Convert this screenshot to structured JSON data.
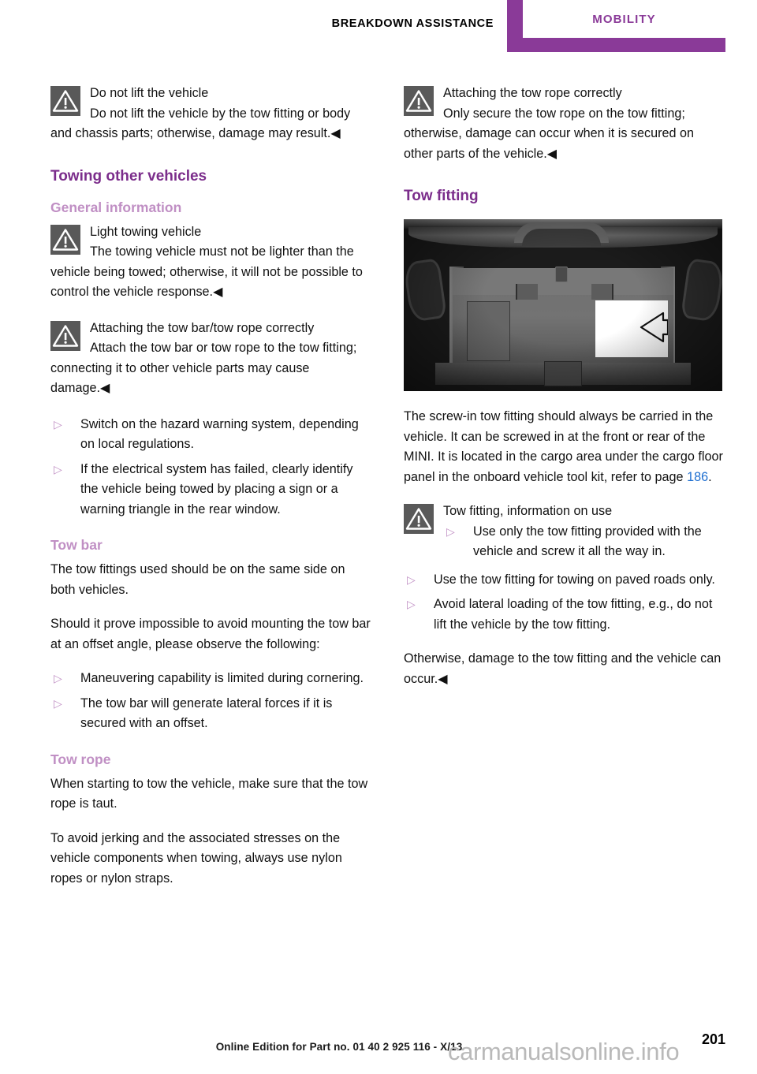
{
  "header": {
    "breadcrumb": "BREAKDOWN ASSISTANCE",
    "tab_label": "MOBILITY",
    "accent_color": "#8a3a98"
  },
  "colors": {
    "heading_major": "#7b2d8b",
    "heading_minor": "#c08fc4",
    "bullet": "#c08fc4",
    "page_reference": "#1f6fd0",
    "warning_icon_bg": "#595959"
  },
  "left_column": {
    "warning_do_not_lift": {
      "icon": "warning-triangle-icon",
      "title": "Do not lift the vehicle",
      "body": "Do not lift the vehicle by the tow fitting or body and chassis parts; otherwise, damage may result.",
      "endmark": "◀"
    },
    "section_title": "Towing other vehicles",
    "subsection_general": "General information",
    "warning_light_towing": {
      "icon": "warning-triangle-icon",
      "title": "Light towing vehicle",
      "body": "The towing vehicle must not be lighter than the vehicle being towed; otherwise, it will not be possible to control the vehicle response.",
      "endmark": "◀"
    },
    "warning_attaching": {
      "icon": "warning-triangle-icon",
      "title": "Attaching the tow bar/tow rope correctly",
      "body": "Attach the tow bar or tow rope to the tow fitting; connecting it to other vehicle parts may cause damage.",
      "endmark": "◀"
    },
    "general_bullets": [
      "Switch on the hazard warning system, depending on local regulations.",
      "If the electrical system has failed, clearly identify the vehicle being towed by placing a sign or a warning triangle in the rear window."
    ],
    "subsection_tow_bar": "Tow bar",
    "tow_bar_para_1": "The tow fittings used should be on the same side on both vehicles.",
    "tow_bar_para_2": "Should it prove impossible to avoid mounting the tow bar at an offset angle, please observe the following:",
    "tow_bar_bullets": [
      "Maneuvering capability is limited during cornering.",
      "The tow bar will generate lateral forces if it is secured with an offset."
    ],
    "subsection_tow_rope": "Tow rope",
    "tow_rope_para_1": "When starting to tow the vehicle, make sure that the tow rope is taut.",
    "tow_rope_para_2": "To avoid jerking and the associated stresses on the vehicle components when towing, always use nylon ropes or nylon straps."
  },
  "right_column": {
    "warning_tow_rope": {
      "icon": "warning-triangle-icon",
      "title": "Attaching the tow rope correctly",
      "body": "Only secure the tow rope on the tow fitting; otherwise, damage can occur when it is secured on other parts of the vehicle.",
      "endmark": "◀"
    },
    "section_title": "Tow fitting",
    "figure": {
      "name": "cargo-area-tow-fitting-photo",
      "description": "Vehicle cargo area with floor panel, white arrow pointing left to the onboard tool kit location"
    },
    "body_para": {
      "before_ref": "The screw-in tow fitting should always be carried in the vehicle. It can be screwed in at the front or rear of the MINI. It is located in the cargo area under the cargo floor panel in the onboard vehicle tool kit, refer to page ",
      "page_ref": "186",
      "after_ref": "."
    },
    "warning_tow_fitting_use": {
      "icon": "warning-triangle-icon",
      "title": "Tow fitting, information on use",
      "indented_bullets": [
        "Use only the tow fitting provided with the vehicle and screw it all the way in."
      ],
      "bullets": [
        "Use the tow fitting for towing on paved roads only.",
        "Avoid lateral loading of the tow fitting, e.g., do not lift the vehicle by the tow fitting."
      ],
      "closing": "Otherwise, damage to the tow fitting and the vehicle can occur.",
      "endmark": "◀"
    }
  },
  "footer": {
    "edition": "Online Edition for Part no. 01 40 2 925 116 - X/13",
    "page_number": "201",
    "watermark": "carmanualsonline.info"
  },
  "glyphs": {
    "bullet_triangle": "▷",
    "endmark_triangle": "◀"
  }
}
